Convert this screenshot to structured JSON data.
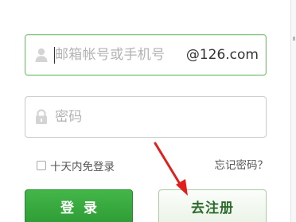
{
  "account_field": {
    "placeholder": "邮箱帐号或手机号",
    "domain_suffix": "@126.com"
  },
  "password_field": {
    "placeholder": "密码"
  },
  "remember_me": {
    "label": "十天内免登录",
    "checked": false
  },
  "forgot_password": {
    "label": "忘记密码？"
  },
  "login_button": {
    "label": "登录"
  },
  "register_button": {
    "label": "去注册"
  },
  "icons": {
    "account": "user-icon",
    "password": "lock-icon",
    "annotation": "red-arrow-icon"
  },
  "colors": {
    "brand_green": "#2c9a33",
    "focus_border": "#7fc47a",
    "annotation_red": "#e0201c"
  }
}
